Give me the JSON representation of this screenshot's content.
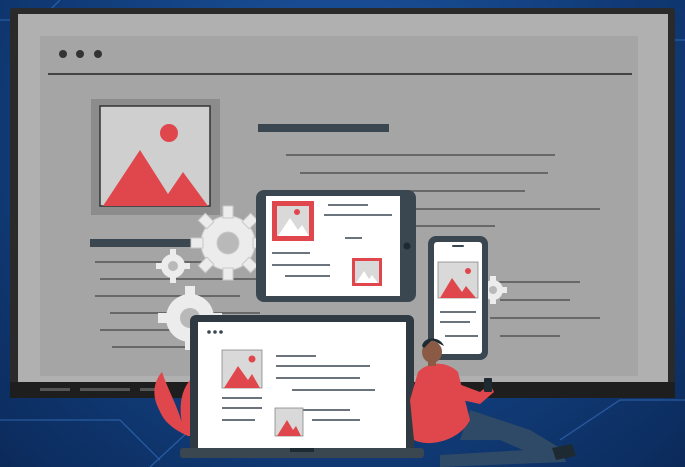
{
  "colors": {
    "background": "#1a4d93",
    "monitor_frame": "#2b2b2b",
    "screen": "#a9a9a9",
    "accent": "#e0474c",
    "device_dark": "#3a4750",
    "device_screen": "#ffffff",
    "gear": "#ededed",
    "image_tile": "#d9d9d9"
  },
  "icons": {
    "window_dots": "three-dots-icon",
    "image_placeholder": "image-placeholder-icon",
    "gear": "gear-icon",
    "person": "person-sitting-illustration",
    "plant": "plant-leaf-illustration"
  }
}
